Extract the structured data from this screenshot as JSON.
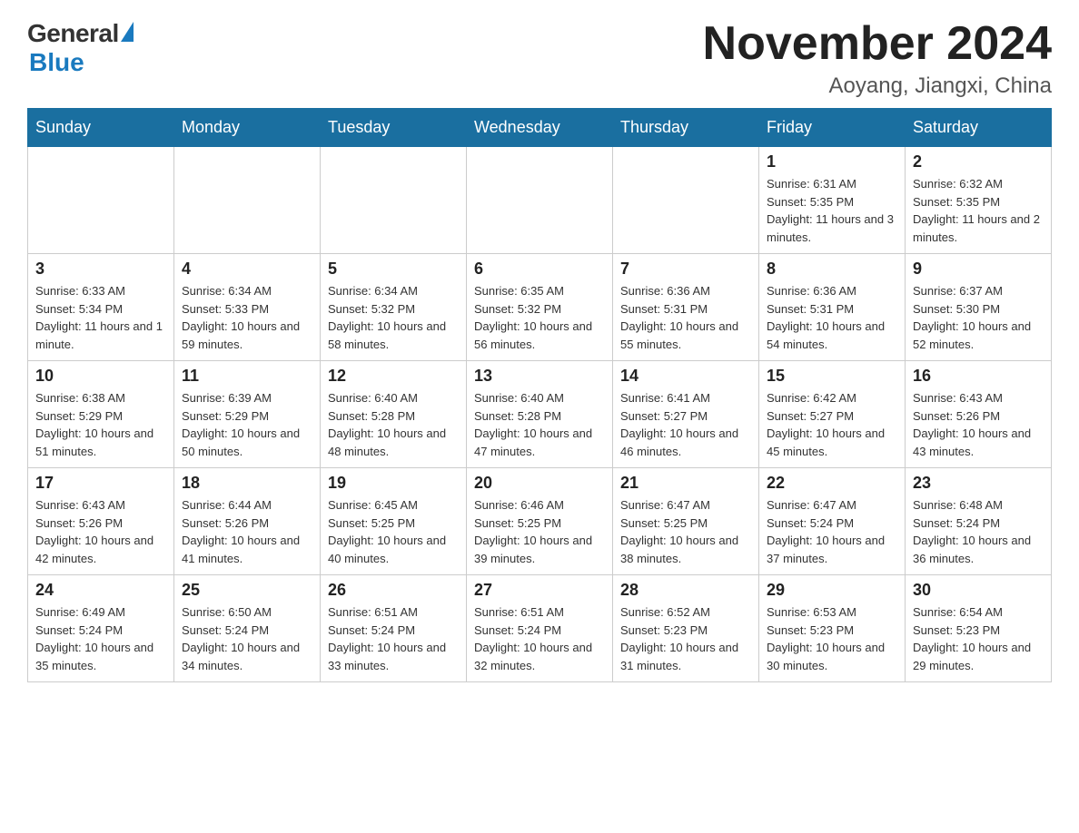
{
  "header": {
    "logo_general": "General",
    "logo_blue": "Blue",
    "month_title": "November 2024",
    "location": "Aoyang, Jiangxi, China"
  },
  "days_of_week": [
    "Sunday",
    "Monday",
    "Tuesday",
    "Wednesday",
    "Thursday",
    "Friday",
    "Saturday"
  ],
  "weeks": [
    [
      {
        "day": "",
        "info": ""
      },
      {
        "day": "",
        "info": ""
      },
      {
        "day": "",
        "info": ""
      },
      {
        "day": "",
        "info": ""
      },
      {
        "day": "",
        "info": ""
      },
      {
        "day": "1",
        "info": "Sunrise: 6:31 AM\nSunset: 5:35 PM\nDaylight: 11 hours and 3 minutes."
      },
      {
        "day": "2",
        "info": "Sunrise: 6:32 AM\nSunset: 5:35 PM\nDaylight: 11 hours and 2 minutes."
      }
    ],
    [
      {
        "day": "3",
        "info": "Sunrise: 6:33 AM\nSunset: 5:34 PM\nDaylight: 11 hours and 1 minute."
      },
      {
        "day": "4",
        "info": "Sunrise: 6:34 AM\nSunset: 5:33 PM\nDaylight: 10 hours and 59 minutes."
      },
      {
        "day": "5",
        "info": "Sunrise: 6:34 AM\nSunset: 5:32 PM\nDaylight: 10 hours and 58 minutes."
      },
      {
        "day": "6",
        "info": "Sunrise: 6:35 AM\nSunset: 5:32 PM\nDaylight: 10 hours and 56 minutes."
      },
      {
        "day": "7",
        "info": "Sunrise: 6:36 AM\nSunset: 5:31 PM\nDaylight: 10 hours and 55 minutes."
      },
      {
        "day": "8",
        "info": "Sunrise: 6:36 AM\nSunset: 5:31 PM\nDaylight: 10 hours and 54 minutes."
      },
      {
        "day": "9",
        "info": "Sunrise: 6:37 AM\nSunset: 5:30 PM\nDaylight: 10 hours and 52 minutes."
      }
    ],
    [
      {
        "day": "10",
        "info": "Sunrise: 6:38 AM\nSunset: 5:29 PM\nDaylight: 10 hours and 51 minutes."
      },
      {
        "day": "11",
        "info": "Sunrise: 6:39 AM\nSunset: 5:29 PM\nDaylight: 10 hours and 50 minutes."
      },
      {
        "day": "12",
        "info": "Sunrise: 6:40 AM\nSunset: 5:28 PM\nDaylight: 10 hours and 48 minutes."
      },
      {
        "day": "13",
        "info": "Sunrise: 6:40 AM\nSunset: 5:28 PM\nDaylight: 10 hours and 47 minutes."
      },
      {
        "day": "14",
        "info": "Sunrise: 6:41 AM\nSunset: 5:27 PM\nDaylight: 10 hours and 46 minutes."
      },
      {
        "day": "15",
        "info": "Sunrise: 6:42 AM\nSunset: 5:27 PM\nDaylight: 10 hours and 45 minutes."
      },
      {
        "day": "16",
        "info": "Sunrise: 6:43 AM\nSunset: 5:26 PM\nDaylight: 10 hours and 43 minutes."
      }
    ],
    [
      {
        "day": "17",
        "info": "Sunrise: 6:43 AM\nSunset: 5:26 PM\nDaylight: 10 hours and 42 minutes."
      },
      {
        "day": "18",
        "info": "Sunrise: 6:44 AM\nSunset: 5:26 PM\nDaylight: 10 hours and 41 minutes."
      },
      {
        "day": "19",
        "info": "Sunrise: 6:45 AM\nSunset: 5:25 PM\nDaylight: 10 hours and 40 minutes."
      },
      {
        "day": "20",
        "info": "Sunrise: 6:46 AM\nSunset: 5:25 PM\nDaylight: 10 hours and 39 minutes."
      },
      {
        "day": "21",
        "info": "Sunrise: 6:47 AM\nSunset: 5:25 PM\nDaylight: 10 hours and 38 minutes."
      },
      {
        "day": "22",
        "info": "Sunrise: 6:47 AM\nSunset: 5:24 PM\nDaylight: 10 hours and 37 minutes."
      },
      {
        "day": "23",
        "info": "Sunrise: 6:48 AM\nSunset: 5:24 PM\nDaylight: 10 hours and 36 minutes."
      }
    ],
    [
      {
        "day": "24",
        "info": "Sunrise: 6:49 AM\nSunset: 5:24 PM\nDaylight: 10 hours and 35 minutes."
      },
      {
        "day": "25",
        "info": "Sunrise: 6:50 AM\nSunset: 5:24 PM\nDaylight: 10 hours and 34 minutes."
      },
      {
        "day": "26",
        "info": "Sunrise: 6:51 AM\nSunset: 5:24 PM\nDaylight: 10 hours and 33 minutes."
      },
      {
        "day": "27",
        "info": "Sunrise: 6:51 AM\nSunset: 5:24 PM\nDaylight: 10 hours and 32 minutes."
      },
      {
        "day": "28",
        "info": "Sunrise: 6:52 AM\nSunset: 5:23 PM\nDaylight: 10 hours and 31 minutes."
      },
      {
        "day": "29",
        "info": "Sunrise: 6:53 AM\nSunset: 5:23 PM\nDaylight: 10 hours and 30 minutes."
      },
      {
        "day": "30",
        "info": "Sunrise: 6:54 AM\nSunset: 5:23 PM\nDaylight: 10 hours and 29 minutes."
      }
    ]
  ]
}
